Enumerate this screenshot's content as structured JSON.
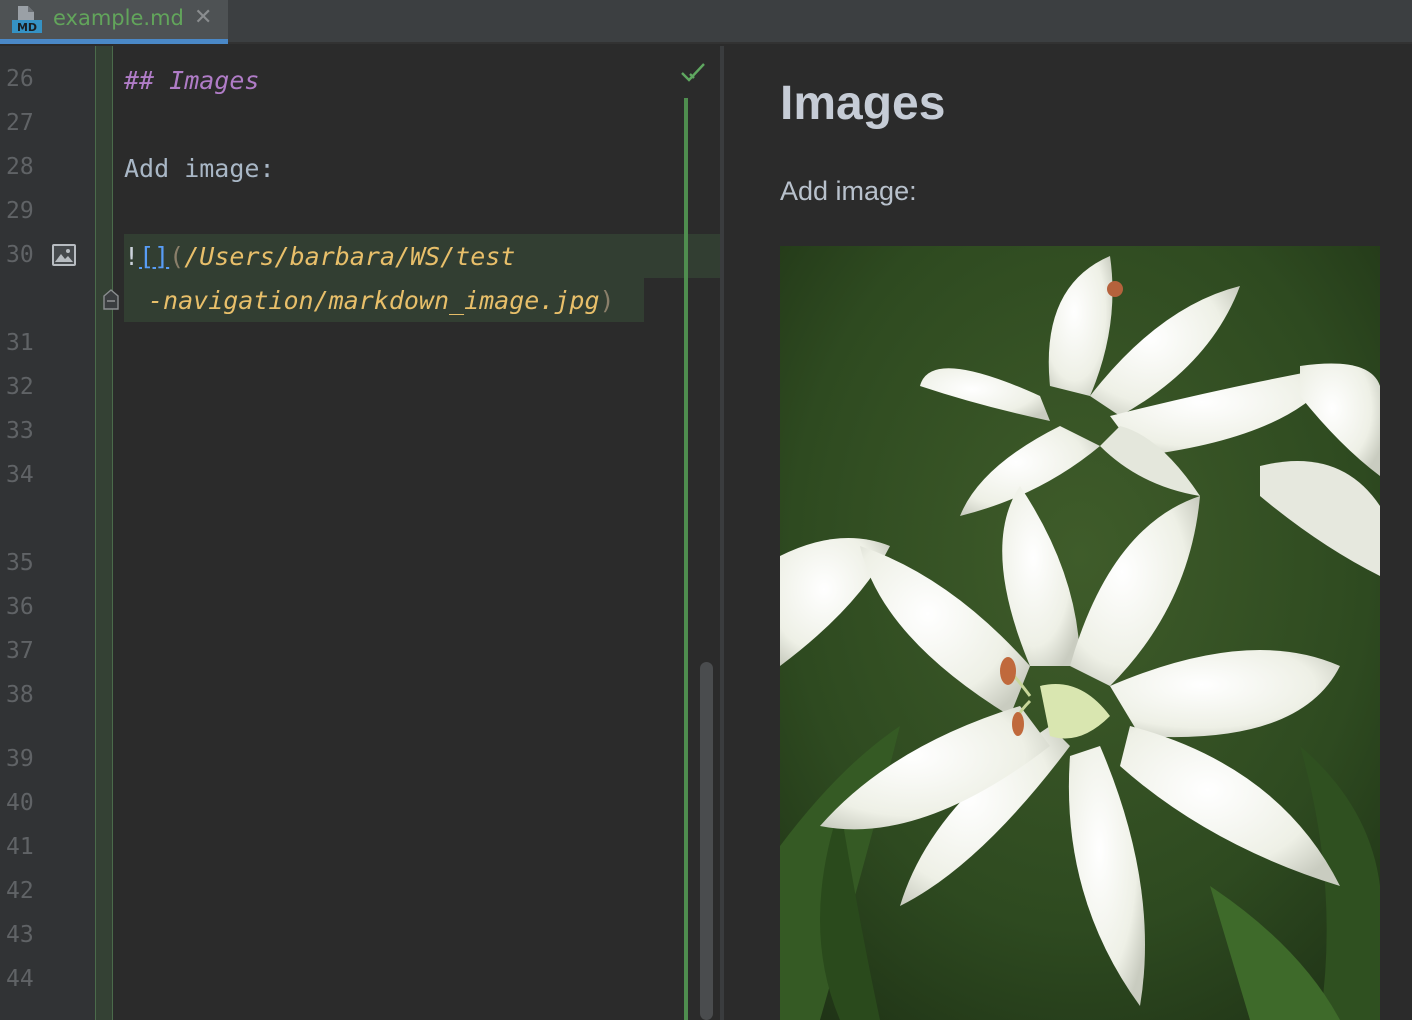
{
  "tab": {
    "label": "example.md",
    "close": "✕",
    "icon": "markdown-file-icon",
    "icon_text": "MD"
  },
  "editor": {
    "line_numbers": [
      "26",
      "27",
      "28",
      "29",
      "30",
      "31",
      "32",
      "33",
      "34",
      "35",
      "36",
      "37",
      "38",
      "39",
      "40",
      "41",
      "42",
      "43",
      "44"
    ],
    "lines": {
      "heading": "## Images",
      "text": "Add image:",
      "bang": "!",
      "brackets": "[]",
      "open_paren": "(",
      "path_part1": "/Users/barbara/WS/test",
      "path_part2": "-navigation/markdown_image.jpg",
      "close_paren": ")"
    },
    "status_icon": "check-icon"
  },
  "preview": {
    "heading": "Images",
    "text": "Add image:",
    "image": "white-lily-flower-image"
  },
  "colors": {
    "tab_label": "#62a55b",
    "heading_md": "#b07cc7",
    "path": "#e8bf6a",
    "link_bracket": "#589df6",
    "change_bar": "#4f8d4f",
    "tab_active_underline": "#4a88c7"
  }
}
